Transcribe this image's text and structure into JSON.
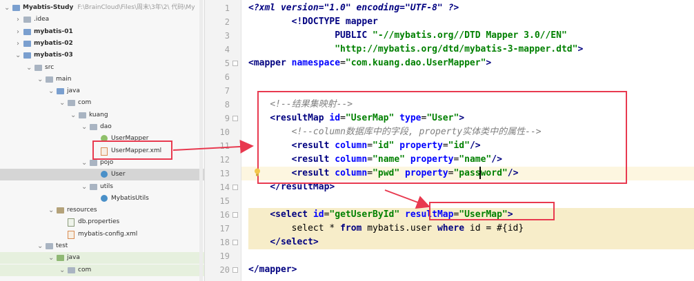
{
  "project_tree": {
    "items": [
      {
        "label": "Myabtis-Study",
        "path": "F:\\BrainCloud\\Files\\周末\\3年\\2\\ 代码\\My",
        "depth": 0,
        "arrow": "▼",
        "icon": "project-icon",
        "bold": true
      },
      {
        "label": ".idea",
        "depth": 1,
        "arrow": "›",
        "icon": "folder-icon"
      },
      {
        "label": "mybatis-01",
        "depth": 1,
        "arrow": "›",
        "icon": "module-folder-icon",
        "bold": true
      },
      {
        "label": "mybatis-02",
        "depth": 1,
        "arrow": "›",
        "icon": "module-folder-icon",
        "bold": true
      },
      {
        "label": "mybatis-03",
        "depth": 1,
        "arrow": "▾",
        "icon": "module-folder-icon",
        "bold": true
      },
      {
        "label": "src",
        "depth": 2,
        "arrow": "▾",
        "icon": "folder-icon"
      },
      {
        "label": "main",
        "depth": 3,
        "arrow": "▾",
        "icon": "folder-icon"
      },
      {
        "label": "java",
        "depth": 4,
        "arrow": "▾",
        "icon": "source-folder-icon"
      },
      {
        "label": "com",
        "depth": 5,
        "arrow": "▾",
        "icon": "package-icon"
      },
      {
        "label": "kuang",
        "depth": 6,
        "arrow": "▾",
        "icon": "package-icon"
      },
      {
        "label": "dao",
        "depth": 7,
        "arrow": "▾",
        "icon": "package-icon"
      },
      {
        "label": "UserMapper",
        "depth": 8,
        "arrow": "",
        "icon": "interface-icon"
      },
      {
        "label": "UserMapper.xml",
        "depth": 8,
        "arrow": "",
        "icon": "xml-file-icon"
      },
      {
        "label": "pojo",
        "depth": 7,
        "arrow": "▾",
        "icon": "package-icon"
      },
      {
        "label": "User",
        "depth": 8,
        "arrow": "",
        "icon": "class-icon",
        "selected": true
      },
      {
        "label": "utils",
        "depth": 7,
        "arrow": "▾",
        "icon": "package-icon"
      },
      {
        "label": "MybatisUtils",
        "depth": 8,
        "arrow": "",
        "icon": "class-icon"
      },
      {
        "label": "resources",
        "depth": 4,
        "arrow": "▾",
        "icon": "resources-folder-icon"
      },
      {
        "label": "db.properties",
        "depth": 5,
        "arrow": "",
        "icon": "properties-file-icon"
      },
      {
        "label": "mybatis-config.xml",
        "depth": 5,
        "arrow": "",
        "icon": "xml-file-icon"
      },
      {
        "label": "test",
        "depth": 3,
        "arrow": "▾",
        "icon": "folder-icon"
      },
      {
        "label": "java",
        "depth": 4,
        "arrow": "▾",
        "icon": "test-folder-icon",
        "green": true
      },
      {
        "label": "com",
        "depth": 5,
        "arrow": "▾",
        "icon": "package-icon",
        "green": true
      }
    ]
  },
  "editor": {
    "line_numbers": [
      "1",
      "2",
      "3",
      "4",
      "5",
      "6",
      "7",
      "8",
      "9",
      "10",
      "11",
      "12",
      "13",
      "14",
      "15",
      "16",
      "17",
      "18",
      "19",
      "20"
    ],
    "current_line": 13,
    "highlighted_lines": [
      16,
      17,
      18
    ],
    "lines": [
      [
        {
          "t": "pi",
          "s": "<?xml version=\"1.0\" encoding=\"UTF-8\" ?>"
        }
      ],
      [
        {
          "t": "plain",
          "s": "        "
        },
        {
          "t": "tag",
          "s": "<!DOCTYPE mapper"
        }
      ],
      [
        {
          "t": "plain",
          "s": "                "
        },
        {
          "t": "tag",
          "s": "PUBLIC "
        },
        {
          "t": "val",
          "s": "\"-//mybatis.org//DTD Mapper 3.0//EN\""
        }
      ],
      [
        {
          "t": "plain",
          "s": "                "
        },
        {
          "t": "val",
          "s": "\"http://mybatis.org/dtd/mybatis-3-mapper.dtd\""
        },
        {
          "t": "tag",
          "s": ">"
        }
      ],
      [
        {
          "t": "tag",
          "s": "<mapper "
        },
        {
          "t": "attr",
          "s": "namespace"
        },
        {
          "t": "plain",
          "s": "="
        },
        {
          "t": "val",
          "s": "\"com.kuang.dao.UserMapper\""
        },
        {
          "t": "tag",
          "s": ">"
        }
      ],
      [],
      [],
      [
        {
          "t": "plain",
          "s": "    "
        },
        {
          "t": "comment",
          "s": "<!--结果集映射-->"
        }
      ],
      [
        {
          "t": "plain",
          "s": "    "
        },
        {
          "t": "tag",
          "s": "<resultMap "
        },
        {
          "t": "attr",
          "s": "id"
        },
        {
          "t": "plain",
          "s": "="
        },
        {
          "t": "val",
          "s": "\"UserMap\""
        },
        {
          "t": "plain",
          "s": " "
        },
        {
          "t": "attr",
          "s": "type"
        },
        {
          "t": "plain",
          "s": "="
        },
        {
          "t": "val",
          "s": "\"User\""
        },
        {
          "t": "tag",
          "s": ">"
        }
      ],
      [
        {
          "t": "plain",
          "s": "        "
        },
        {
          "t": "comment",
          "s": "<!--column数据库中的字段, property实体类中的属性-->"
        }
      ],
      [
        {
          "t": "plain",
          "s": "        "
        },
        {
          "t": "tag",
          "s": "<result "
        },
        {
          "t": "attr",
          "s": "column"
        },
        {
          "t": "plain",
          "s": "="
        },
        {
          "t": "val",
          "s": "\"id\""
        },
        {
          "t": "plain",
          "s": " "
        },
        {
          "t": "attr",
          "s": "property"
        },
        {
          "t": "plain",
          "s": "="
        },
        {
          "t": "val",
          "s": "\"id\""
        },
        {
          "t": "tag",
          "s": "/>"
        }
      ],
      [
        {
          "t": "plain",
          "s": "        "
        },
        {
          "t": "tag",
          "s": "<result "
        },
        {
          "t": "attr",
          "s": "column"
        },
        {
          "t": "plain",
          "s": "="
        },
        {
          "t": "val",
          "s": "\"name\""
        },
        {
          "t": "plain",
          "s": " "
        },
        {
          "t": "attr",
          "s": "property"
        },
        {
          "t": "plain",
          "s": "="
        },
        {
          "t": "val",
          "s": "\"name\""
        },
        {
          "t": "tag",
          "s": "/>"
        }
      ],
      [
        {
          "t": "plain",
          "s": "        "
        },
        {
          "t": "tag",
          "s": "<result "
        },
        {
          "t": "attr",
          "s": "column"
        },
        {
          "t": "plain",
          "s": "="
        },
        {
          "t": "val",
          "s": "\"pwd\""
        },
        {
          "t": "plain",
          "s": " "
        },
        {
          "t": "attr",
          "s": "property"
        },
        {
          "t": "plain",
          "s": "="
        },
        {
          "t": "val",
          "s": "\"password\""
        },
        {
          "t": "tag",
          "s": "/>"
        }
      ],
      [
        {
          "t": "plain",
          "s": "    "
        },
        {
          "t": "tag",
          "s": "</resultMap>"
        }
      ],
      [],
      [
        {
          "t": "plain",
          "s": "    "
        },
        {
          "t": "tag",
          "s": "<select "
        },
        {
          "t": "attr",
          "s": "id"
        },
        {
          "t": "plain",
          "s": "="
        },
        {
          "t": "val",
          "s": "\"getUserById\""
        },
        {
          "t": "plain",
          "s": " "
        },
        {
          "t": "attr",
          "s": "resultMap"
        },
        {
          "t": "plain",
          "s": "="
        },
        {
          "t": "val",
          "s": "\"UserMap\""
        },
        {
          "t": "tag",
          "s": ">"
        }
      ],
      [
        {
          "t": "plain",
          "s": "        select * "
        },
        {
          "t": "kw",
          "s": "from"
        },
        {
          "t": "plain",
          "s": " mybatis.user "
        },
        {
          "t": "kw",
          "s": "where"
        },
        {
          "t": "plain",
          "s": " id = #{id}"
        }
      ],
      [
        {
          "t": "plain",
          "s": "    "
        },
        {
          "t": "tag",
          "s": "</select>"
        }
      ],
      [],
      [
        {
          "t": "tag",
          "s": "</mapper>"
        }
      ]
    ]
  },
  "colors": {
    "annotation_red": "#e8394f",
    "current_line_bg": "#fdf6e0",
    "sql_highlight_bg": "#f7edc9",
    "selected_tree_bg": "#d5d5d5"
  }
}
